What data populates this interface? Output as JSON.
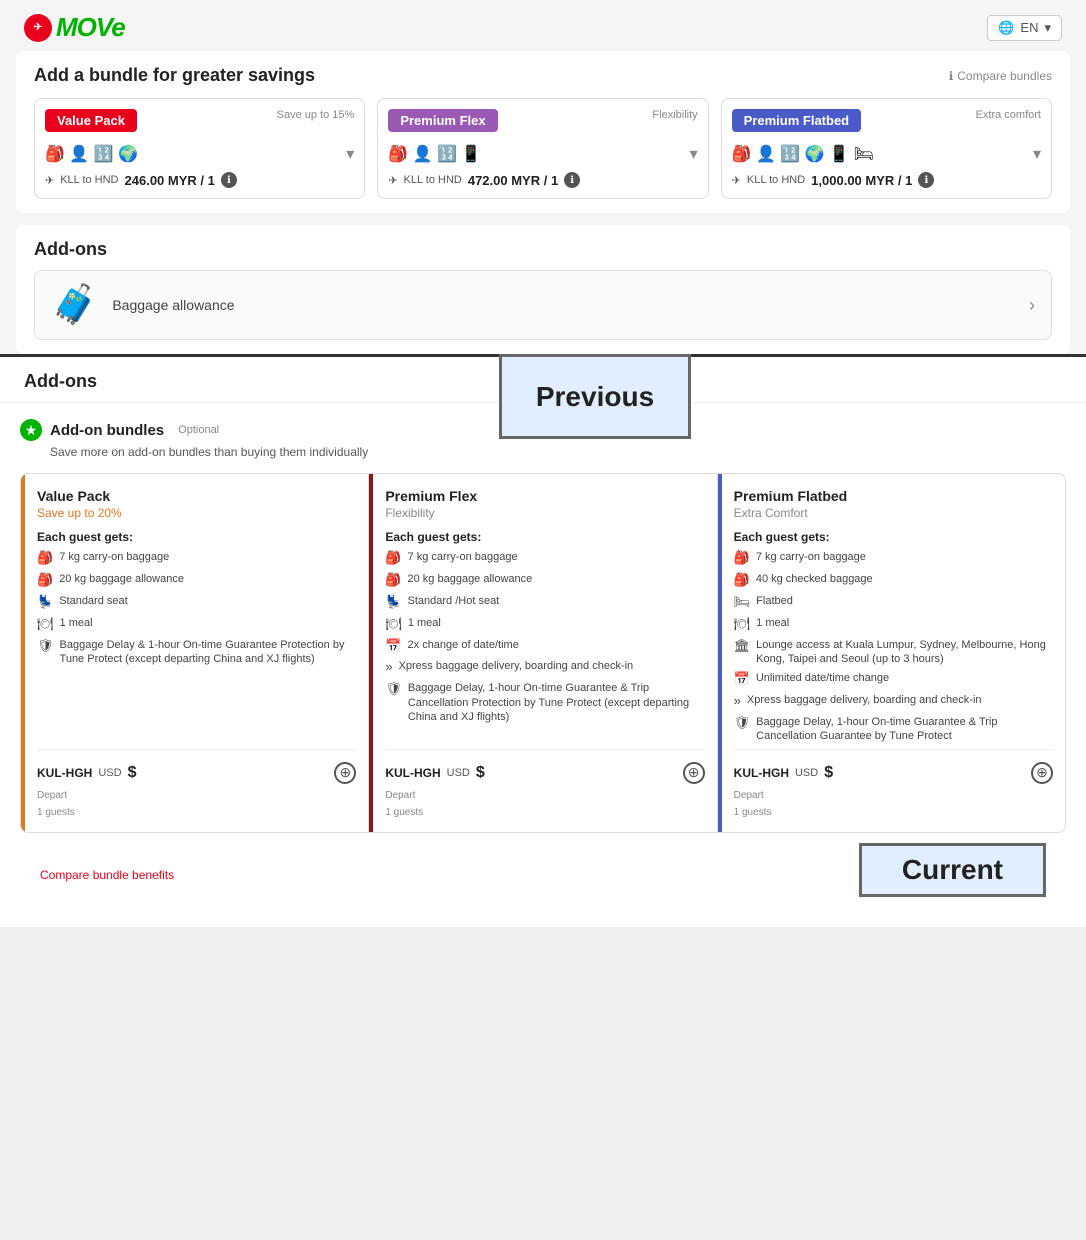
{
  "header": {
    "logo_text": "MOVe",
    "lang": "EN"
  },
  "top": {
    "bundle_section": {
      "title": "Add a bundle for greater savings",
      "compare_link": "Compare bundles",
      "cards": [
        {
          "badge": "Value Pack",
          "badge_class": "badge-red",
          "subtitle": "Save up to 15%",
          "route": "KLL to HND",
          "price": "246.00 MYR / 1",
          "icons": "🎒 👤 🔢 🌍"
        },
        {
          "badge": "Premium Flex",
          "badge_class": "badge-purple",
          "subtitle": "Flexibility",
          "route": "KLL to HND",
          "price": "472.00 MYR / 1",
          "icons": "🎒 👤 🔢 📱"
        },
        {
          "badge": "Premium Flatbed",
          "badge_class": "badge-blue",
          "subtitle": "Extra comfort",
          "route": "KLL to HND",
          "price": "1,000.00 MYR / 1",
          "icons": "🎒 👤 🔢 🌍 📱 🛏"
        }
      ]
    },
    "addons": {
      "title": "Add-ons",
      "baggage_label": "Baggage allowance",
      "baggage_emoji": "🧳"
    },
    "previous_label": "Previous"
  },
  "bottom": {
    "addons_title": "Add-ons",
    "addon_bundles_title": "Add-on bundles",
    "optional_label": "Optional",
    "subtitle": "Save more on add-on bundles than buying them individually",
    "cards": [
      {
        "title": "Value Pack",
        "subtitle": "Save up to 20%",
        "subtitle_class": "bc-sub-orange",
        "border_class": "bc-orange",
        "each_guest": "Each guest gets:",
        "perks": [
          {
            "icon": "🎒",
            "text": "7 kg carry-on baggage"
          },
          {
            "icon": "🎒",
            "text": "20 kg baggage allowance"
          },
          {
            "icon": "💺",
            "text": "Standard seat"
          },
          {
            "icon": "🍽",
            "text": "1 meal"
          },
          {
            "icon": "🛡",
            "text": "Baggage Delay & 1-hour On-time Guarantee Protection by Tune Protect (except departing China and XJ flights)"
          }
        ],
        "route": "KUL-HGH",
        "currency": "USD",
        "price": "$",
        "depart": "Depart",
        "guests": "1 guests"
      },
      {
        "title": "Premium Flex",
        "subtitle": "Flexibility",
        "subtitle_class": "bc-sub",
        "border_class": "bc-maroon",
        "each_guest": "Each guest gets:",
        "perks": [
          {
            "icon": "🎒",
            "text": "7 kg carry-on baggage"
          },
          {
            "icon": "🎒",
            "text": "20 kg baggage allowance"
          },
          {
            "icon": "💺",
            "text": "Standard /Hot seat"
          },
          {
            "icon": "🍽",
            "text": "1 meal"
          },
          {
            "icon": "📅",
            "text": "2x change of date/time"
          },
          {
            "icon": "»",
            "text": "Xpress baggage delivery, boarding and check-in"
          },
          {
            "icon": "🛡",
            "text": "Baggage Delay, 1-hour On-time Guarantee & Trip Cancellation Protection by Tune Protect (except departing China and XJ flights)"
          }
        ],
        "route": "KUL-HGH",
        "currency": "USD",
        "price": "$",
        "depart": "Depart",
        "guests": "1 guests"
      },
      {
        "title": "Premium Flatbed",
        "subtitle": "Extra Comfort",
        "subtitle_class": "bc-sub",
        "border_class": "bc-indigo",
        "each_guest": "Each guest gets:",
        "perks": [
          {
            "icon": "🎒",
            "text": "7 kg carry-on baggage"
          },
          {
            "icon": "🎒",
            "text": "40 kg checked baggage"
          },
          {
            "icon": "🛏",
            "text": "Flatbed"
          },
          {
            "icon": "🍽",
            "text": "1 meal"
          },
          {
            "icon": "🏛",
            "text": "Lounge access at Kuala Lumpur, Sydney, Melbourne, Hong Kong, Taipei and Seoul (up to 3 hours)"
          },
          {
            "icon": "📅",
            "text": "Unlimited date/time change"
          },
          {
            "icon": "»",
            "text": "Xpress baggage delivery, boarding and check-in"
          },
          {
            "icon": "🛡",
            "text": "Baggage Delay, 1-hour On-time Guarantee & Trip Cancellation Guarantee by Tune Protect"
          }
        ],
        "route": "KUL-HGH",
        "currency": "USD",
        "price": "$",
        "depart": "Depart",
        "guests": "1 guests"
      }
    ],
    "compare_bundle_benefits": "Compare bundle benefits",
    "current_label": "Current"
  }
}
